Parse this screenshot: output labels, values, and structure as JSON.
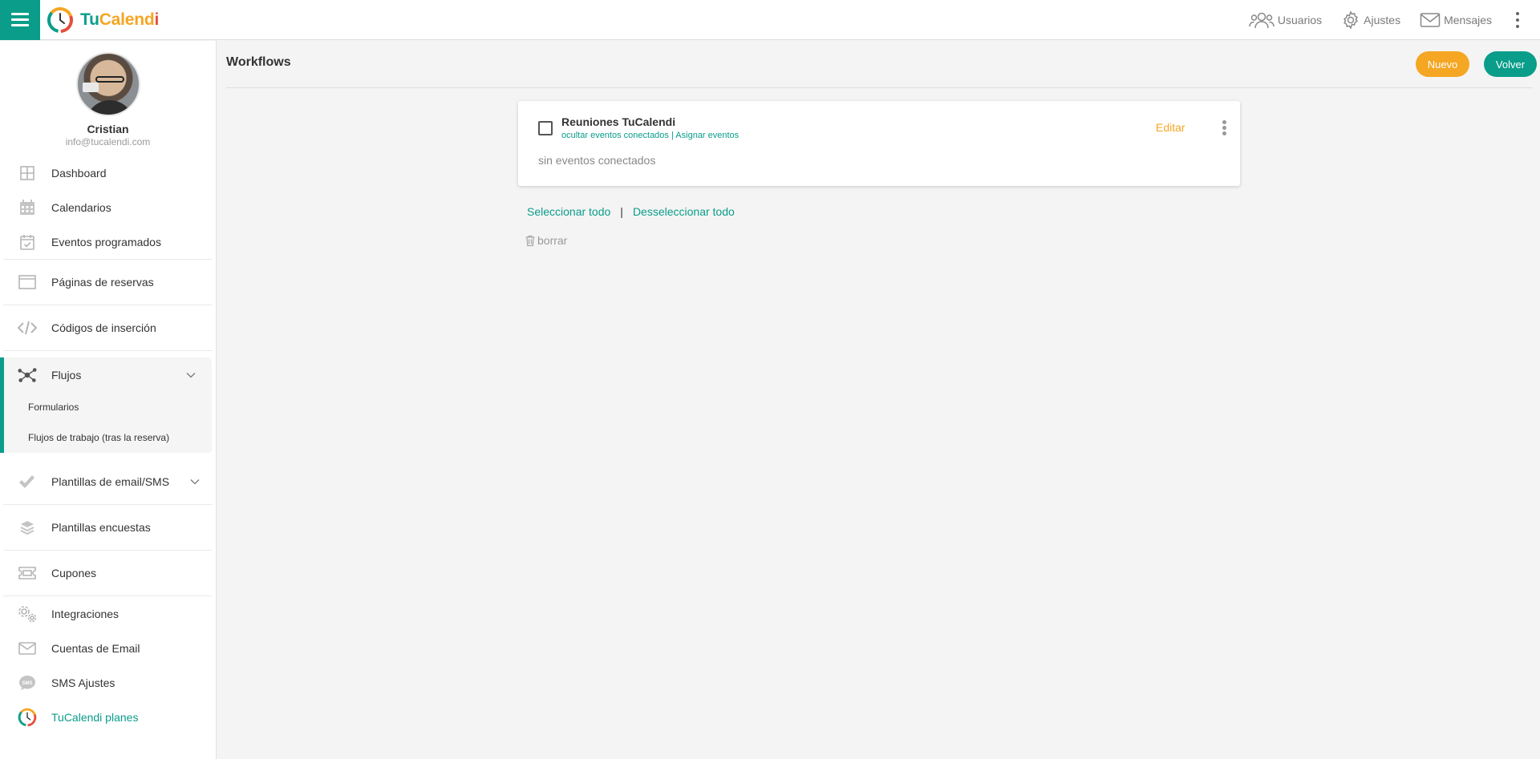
{
  "brand": {
    "name_part1": "Tu",
    "name_part2": "Calend",
    "name_part3": "i",
    "colors": {
      "primary": "#0a9d8a",
      "accent": "#f5a623",
      "red": "#e74c3c"
    }
  },
  "topbar": {
    "usuarios": "Usuarios",
    "ajustes": "Ajustes",
    "mensajes": "Mensajes"
  },
  "profile": {
    "name": "Cristian",
    "email": "info@tucalendi.com"
  },
  "sidebar": {
    "items": [
      {
        "label": "Dashboard",
        "icon": "dashboard-icon"
      },
      {
        "label": "Calendarios",
        "icon": "calendar-icon"
      },
      {
        "label": "Eventos programados",
        "icon": "calendar-check-icon"
      },
      {
        "label": "Páginas de reservas",
        "icon": "browser-window-icon"
      },
      {
        "label": "Códigos de inserción",
        "icon": "code-icon"
      },
      {
        "label": "Flujos",
        "icon": "network-icon"
      },
      {
        "label": "Plantillas de email/SMS",
        "icon": "double-check-icon"
      },
      {
        "label": "Plantillas encuestas",
        "icon": "layers-icon"
      },
      {
        "label": "Cupones",
        "icon": "ticket-icon"
      },
      {
        "label": "Integraciones",
        "icon": "gears-icon"
      },
      {
        "label": "Cuentas de Email",
        "icon": "envelope-icon"
      },
      {
        "label": "SMS Ajustes",
        "icon": "sms-bubble-icon"
      },
      {
        "label": "TuCalendi planes",
        "icon": "tucalendi-logo-icon"
      }
    ],
    "flujos_sub": [
      {
        "label": "Formularios"
      },
      {
        "label": "Flujos de trabajo (tras la reserva)"
      }
    ]
  },
  "main": {
    "title": "Workflows",
    "btn_nuevo": "Nuevo",
    "btn_volver": "Volver",
    "workflow": {
      "title": "Reuniones TuCalendi",
      "link_hide": "ocultar eventos conectados",
      "link_sep": "|",
      "link_assign": "Asignar eventos",
      "edit": "Editar",
      "empty": "sin eventos conectados",
      "checked": false
    },
    "select_all": "Seleccionar todo",
    "select_sep": "|",
    "deselect_all": "Desseleccionar todo",
    "delete": "borrar"
  }
}
